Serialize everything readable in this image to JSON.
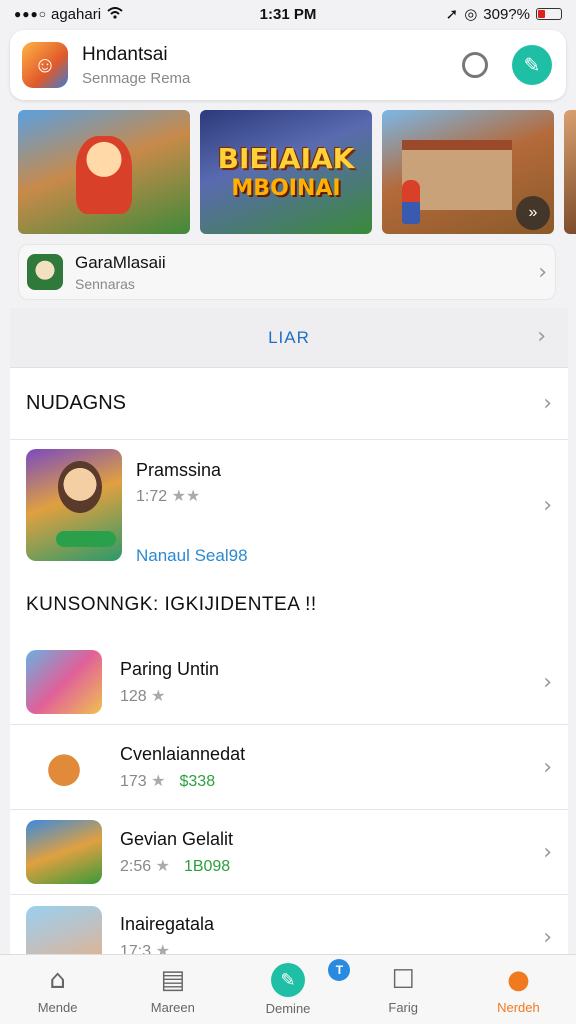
{
  "status_bar": {
    "signal_dots": "●●●○",
    "carrier": "agahari",
    "time": "1:31 PM",
    "battery_text": "309?%",
    "battery_level": 0.3
  },
  "header": {
    "title": "Hndantsai",
    "subtitle": "Senmage Rema",
    "icon": "game-character-icon",
    "teal_button_icon": "pencil-icon"
  },
  "banners": [
    {
      "title": "",
      "subtitle": ""
    },
    {
      "title": "BIEIAIAK",
      "subtitle": "MBOINAI"
    },
    {
      "title": "",
      "subtitle": ""
    }
  ],
  "mini_app": {
    "title": "GaraMlasaii",
    "subtitle": "Sennaras"
  },
  "list": {
    "lar_label": "LIAR",
    "section_title": "NUDAGNS",
    "featured": {
      "name": "Pramssina",
      "rating": "1:72",
      "stars": "★★",
      "link": "Nanaul Seal98"
    },
    "subhead": "KUNSONNGK: IGKIJIDENTEA !!",
    "apps": [
      {
        "name": "Paring Untin",
        "rating": "128",
        "price": ""
      },
      {
        "name": "Cvenlaiannedat",
        "rating": "173",
        "price": "$338"
      },
      {
        "name": "Gevian Gelalit",
        "rating": "2:56",
        "price": "1B098"
      },
      {
        "name": "Inairegatala",
        "rating": "17:3",
        "price": ""
      }
    ]
  },
  "tabbar": {
    "tabs": [
      {
        "label": "Mende",
        "icon": "home-icon"
      },
      {
        "label": "Mareen",
        "icon": "storefront-icon"
      },
      {
        "label": "Demine",
        "icon": "paint-icon",
        "badge": "T"
      },
      {
        "label": "Farig",
        "icon": "box-icon"
      },
      {
        "label": "Nerdeh",
        "icon": "profile-icon"
      }
    ],
    "active_color": "#f07a20"
  },
  "colors": {
    "accent_teal": "#1fbfa6",
    "link_blue": "#2b8ad0",
    "price_green": "#2aa040",
    "active_orange": "#f07a20"
  }
}
